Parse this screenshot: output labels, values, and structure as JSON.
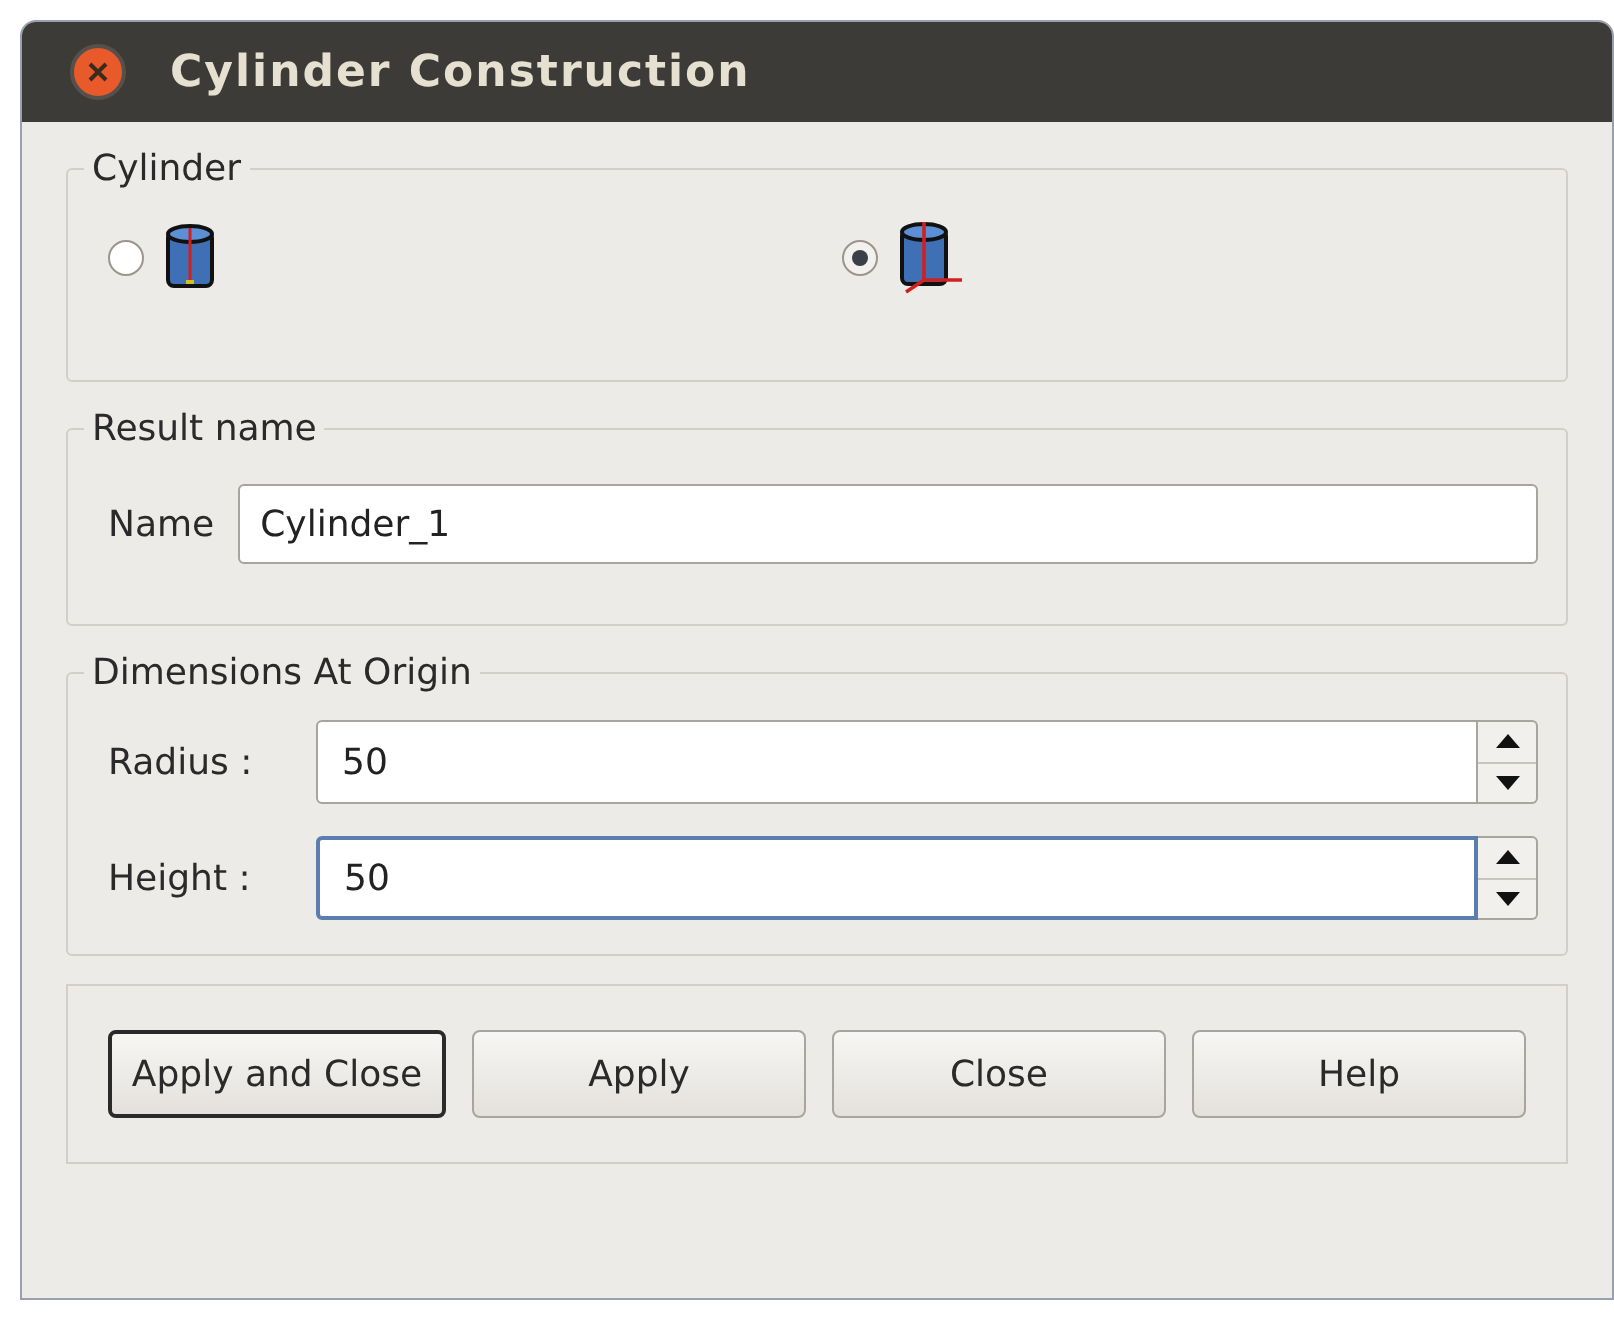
{
  "window": {
    "title": "Cylinder Construction"
  },
  "cylinder_group": {
    "title": "Cylinder",
    "options": [
      {
        "kind": "cylinder",
        "selected": false
      },
      {
        "kind": "cylinder_axes",
        "selected": true
      }
    ]
  },
  "result_group": {
    "title": "Result name",
    "label": "Name",
    "value": "Cylinder_1"
  },
  "dimensions_group": {
    "title": "Dimensions At Origin",
    "fields": [
      {
        "label": "Radius :",
        "value": "50",
        "focused": false
      },
      {
        "label": "Height :",
        "value": "50",
        "focused": true
      }
    ]
  },
  "buttons": [
    {
      "label": "Apply and Close",
      "default": true
    },
    {
      "label": "Apply",
      "default": false
    },
    {
      "label": "Close",
      "default": false
    },
    {
      "label": "Help",
      "default": false
    }
  ]
}
